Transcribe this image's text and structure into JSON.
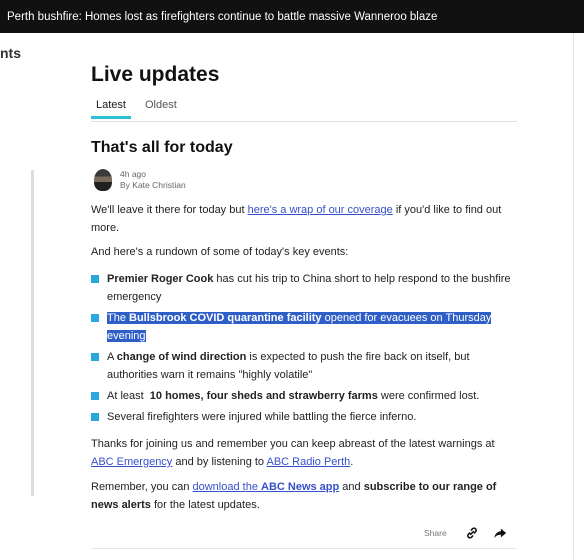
{
  "banner": {
    "headline": "Perth bushfire: Homes lost as firefighters continue to battle massive Wanneroo blaze"
  },
  "sidebar": {
    "fragment": "nts"
  },
  "live": {
    "title": "Live updates",
    "tabs": [
      {
        "label": "Latest"
      },
      {
        "label": "Oldest"
      }
    ]
  },
  "post": {
    "title": "That's all for today",
    "time": "4h ago",
    "author": "By Kate Christian",
    "intro_a": "We'll leave it there for today but ",
    "intro_link": "here's a wrap of our coverage",
    "intro_b": " if you'd like to find out more.",
    "rundown": "And here's a rundown of some of today's key events:",
    "bullets": {
      "b1_bold": "Premier Roger Cook",
      "b1_rest": " has cut his trip to China short to help respond to the bushfire emergency",
      "b2_a": "The ",
      "b2_bold": "Bullsbrook COVID quarantine facility",
      "b2_rest": " opened for evacuees on Thursday evening",
      "b3_a": "A ",
      "b3_bold": "change of wind direction",
      "b3_rest": " is expected to push the fire back on itself, but authorities warn it remains \"highly volatile\"",
      "b4_a": "At least  ",
      "b4_bold": "10 homes, four sheds and strawberry farms",
      "b4_rest": " were confirmed lost.",
      "b5": "Several firefighters were injured while battling the fierce inferno."
    },
    "thanks_a": "Thanks for joining us and remember you can keep abreast of the latest warnings at ",
    "thanks_link1": "ABC Emergency",
    "thanks_b": " and by listening to ",
    "thanks_link2": "ABC Radio Perth",
    "thanks_c": ".",
    "remember_a": "Remember, you can ",
    "remember_link_a": "download the ",
    "remember_link_bold": "ABC News app",
    "remember_b": " and ",
    "remember_bold": "subscribe to our range of news alerts",
    "remember_c": " for the latest updates.",
    "share_label": "Share"
  },
  "icons": {
    "link": "link-icon",
    "share": "share-arrow-icon"
  },
  "colors": {
    "tab_indicator": "#2ec0d8",
    "bullet": "#29a8e0",
    "link": "#3650c9",
    "selection": "#2f5fc6",
    "banner": "#111111"
  }
}
